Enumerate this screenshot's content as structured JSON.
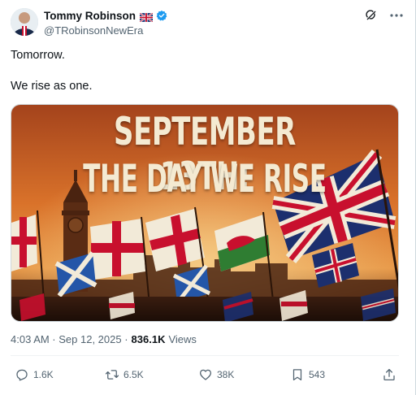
{
  "post": {
    "author": {
      "display_name": "Tommy Robinson",
      "handle": "@TRobinsonNewEra"
    },
    "text": {
      "line1": "Tomorrow.",
      "line2": "We rise as one."
    },
    "image_text": {
      "headline_line1": "SEPTEMBER 13TH:",
      "headline_line2": "THE DAY WE RISE"
    },
    "meta": {
      "timestamp": "4:03 AM · Sep 12, 2025 ·",
      "views_count": "836.1K",
      "views_label": "Views"
    },
    "actions": {
      "replies": "1.6K",
      "reposts": "6.5K",
      "likes": "38K",
      "bookmarks": "543"
    }
  },
  "icons": {
    "flag": "uk-flag-icon",
    "verified": "verified-badge-icon",
    "grok": "grok-icon",
    "more": "more-icon",
    "reply": "reply-icon",
    "repost": "repost-icon",
    "like": "like-icon",
    "bookmark": "bookmark-icon",
    "share": "share-icon"
  },
  "colors": {
    "verified_blue": "#1d9bf0",
    "secondary_text": "#536471",
    "primary_text": "#0f1419",
    "sky_orange": "#d9722a",
    "headline_cream": "#f4ead2"
  }
}
